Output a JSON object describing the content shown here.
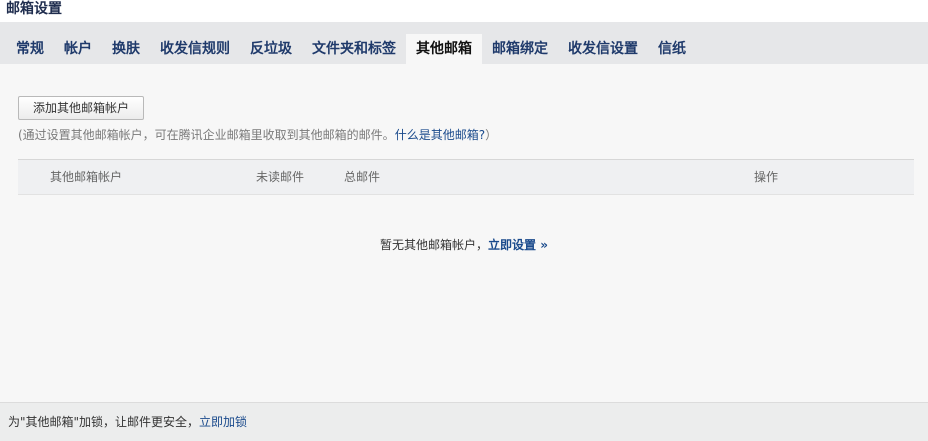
{
  "page_title": "邮箱设置",
  "tabs": [
    {
      "label": "常规"
    },
    {
      "label": "帐户"
    },
    {
      "label": "换肤"
    },
    {
      "label": "收发信规则"
    },
    {
      "label": "反垃圾"
    },
    {
      "label": "文件夹和标签"
    },
    {
      "label": "其他邮箱",
      "active": true
    },
    {
      "label": "邮箱绑定"
    },
    {
      "label": "收发信设置"
    },
    {
      "label": "信纸"
    }
  ],
  "toolbar": {
    "add_button_label": "添加其他邮箱帐户"
  },
  "hint": {
    "prefix": "(通过设置其他邮箱帐户，可在腾讯企业邮箱里收取到其他邮箱的邮件。",
    "link": "什么是其他邮箱?",
    "suffix": "）"
  },
  "table": {
    "columns": [
      "其他邮箱帐户",
      "未读邮件",
      "总邮件",
      "操作"
    ]
  },
  "empty": {
    "text": "暂无其他邮箱帐户，",
    "link": "立即设置 »"
  },
  "footer": {
    "text": "为\"其他邮箱\"加锁，让邮件更安全，",
    "link": "立即加锁"
  },
  "colors": {
    "title": "#1f2d4e",
    "link": "#1a4a8c",
    "tab_bar": "#e6e7e9",
    "background": "#f7f7f7"
  }
}
